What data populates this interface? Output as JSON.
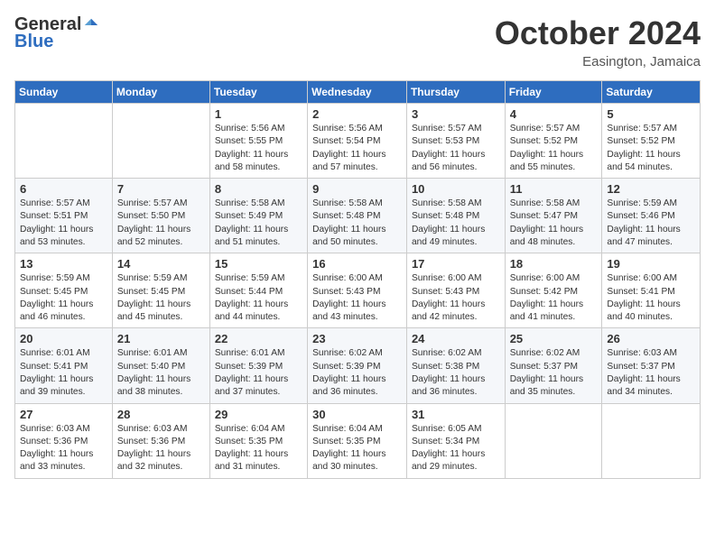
{
  "header": {
    "logo_general": "General",
    "logo_blue": "Blue",
    "month": "October 2024",
    "location": "Easington, Jamaica"
  },
  "days_of_week": [
    "Sunday",
    "Monday",
    "Tuesday",
    "Wednesday",
    "Thursday",
    "Friday",
    "Saturday"
  ],
  "weeks": [
    [
      {
        "day": "",
        "info": ""
      },
      {
        "day": "",
        "info": ""
      },
      {
        "day": "1",
        "info": "Sunrise: 5:56 AM\nSunset: 5:55 PM\nDaylight: 11 hours and 58 minutes."
      },
      {
        "day": "2",
        "info": "Sunrise: 5:56 AM\nSunset: 5:54 PM\nDaylight: 11 hours and 57 minutes."
      },
      {
        "day": "3",
        "info": "Sunrise: 5:57 AM\nSunset: 5:53 PM\nDaylight: 11 hours and 56 minutes."
      },
      {
        "day": "4",
        "info": "Sunrise: 5:57 AM\nSunset: 5:52 PM\nDaylight: 11 hours and 55 minutes."
      },
      {
        "day": "5",
        "info": "Sunrise: 5:57 AM\nSunset: 5:52 PM\nDaylight: 11 hours and 54 minutes."
      }
    ],
    [
      {
        "day": "6",
        "info": "Sunrise: 5:57 AM\nSunset: 5:51 PM\nDaylight: 11 hours and 53 minutes."
      },
      {
        "day": "7",
        "info": "Sunrise: 5:57 AM\nSunset: 5:50 PM\nDaylight: 11 hours and 52 minutes."
      },
      {
        "day": "8",
        "info": "Sunrise: 5:58 AM\nSunset: 5:49 PM\nDaylight: 11 hours and 51 minutes."
      },
      {
        "day": "9",
        "info": "Sunrise: 5:58 AM\nSunset: 5:48 PM\nDaylight: 11 hours and 50 minutes."
      },
      {
        "day": "10",
        "info": "Sunrise: 5:58 AM\nSunset: 5:48 PM\nDaylight: 11 hours and 49 minutes."
      },
      {
        "day": "11",
        "info": "Sunrise: 5:58 AM\nSunset: 5:47 PM\nDaylight: 11 hours and 48 minutes."
      },
      {
        "day": "12",
        "info": "Sunrise: 5:59 AM\nSunset: 5:46 PM\nDaylight: 11 hours and 47 minutes."
      }
    ],
    [
      {
        "day": "13",
        "info": "Sunrise: 5:59 AM\nSunset: 5:45 PM\nDaylight: 11 hours and 46 minutes."
      },
      {
        "day": "14",
        "info": "Sunrise: 5:59 AM\nSunset: 5:45 PM\nDaylight: 11 hours and 45 minutes."
      },
      {
        "day": "15",
        "info": "Sunrise: 5:59 AM\nSunset: 5:44 PM\nDaylight: 11 hours and 44 minutes."
      },
      {
        "day": "16",
        "info": "Sunrise: 6:00 AM\nSunset: 5:43 PM\nDaylight: 11 hours and 43 minutes."
      },
      {
        "day": "17",
        "info": "Sunrise: 6:00 AM\nSunset: 5:43 PM\nDaylight: 11 hours and 42 minutes."
      },
      {
        "day": "18",
        "info": "Sunrise: 6:00 AM\nSunset: 5:42 PM\nDaylight: 11 hours and 41 minutes."
      },
      {
        "day": "19",
        "info": "Sunrise: 6:00 AM\nSunset: 5:41 PM\nDaylight: 11 hours and 40 minutes."
      }
    ],
    [
      {
        "day": "20",
        "info": "Sunrise: 6:01 AM\nSunset: 5:41 PM\nDaylight: 11 hours and 39 minutes."
      },
      {
        "day": "21",
        "info": "Sunrise: 6:01 AM\nSunset: 5:40 PM\nDaylight: 11 hours and 38 minutes."
      },
      {
        "day": "22",
        "info": "Sunrise: 6:01 AM\nSunset: 5:39 PM\nDaylight: 11 hours and 37 minutes."
      },
      {
        "day": "23",
        "info": "Sunrise: 6:02 AM\nSunset: 5:39 PM\nDaylight: 11 hours and 36 minutes."
      },
      {
        "day": "24",
        "info": "Sunrise: 6:02 AM\nSunset: 5:38 PM\nDaylight: 11 hours and 36 minutes."
      },
      {
        "day": "25",
        "info": "Sunrise: 6:02 AM\nSunset: 5:37 PM\nDaylight: 11 hours and 35 minutes."
      },
      {
        "day": "26",
        "info": "Sunrise: 6:03 AM\nSunset: 5:37 PM\nDaylight: 11 hours and 34 minutes."
      }
    ],
    [
      {
        "day": "27",
        "info": "Sunrise: 6:03 AM\nSunset: 5:36 PM\nDaylight: 11 hours and 33 minutes."
      },
      {
        "day": "28",
        "info": "Sunrise: 6:03 AM\nSunset: 5:36 PM\nDaylight: 11 hours and 32 minutes."
      },
      {
        "day": "29",
        "info": "Sunrise: 6:04 AM\nSunset: 5:35 PM\nDaylight: 11 hours and 31 minutes."
      },
      {
        "day": "30",
        "info": "Sunrise: 6:04 AM\nSunset: 5:35 PM\nDaylight: 11 hours and 30 minutes."
      },
      {
        "day": "31",
        "info": "Sunrise: 6:05 AM\nSunset: 5:34 PM\nDaylight: 11 hours and 29 minutes."
      },
      {
        "day": "",
        "info": ""
      },
      {
        "day": "",
        "info": ""
      }
    ]
  ]
}
